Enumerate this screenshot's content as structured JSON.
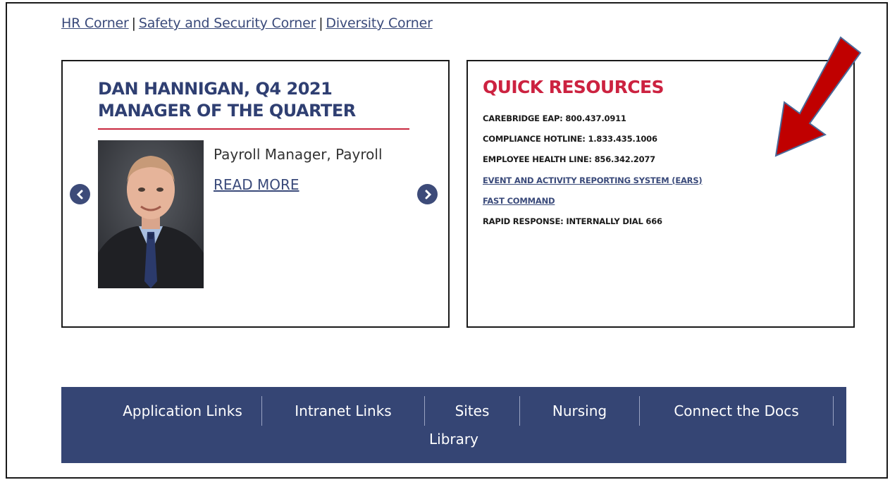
{
  "top_links": [
    {
      "label": "HR Corner"
    },
    {
      "label": "Safety and Security Corner"
    },
    {
      "label": "Diversity Corner"
    }
  ],
  "top_links_separator": "|",
  "manager_card": {
    "title": "DAN HANNIGAN, Q4 2021 MANAGER OF THE QUARTER",
    "role": "Payroll Manager, Payroll",
    "read_more": "READ MORE",
    "prev_icon": "chevron-left-icon",
    "next_icon": "chevron-right-icon"
  },
  "quick_resources": {
    "title": "QUICK RESOURCES",
    "items": [
      {
        "label": "CAREBRIDGE EAP: 800.437.0911",
        "link": false
      },
      {
        "label": "COMPLIANCE HOTLINE: 1.833.435.1006",
        "link": false
      },
      {
        "label": "EMPLOYEE HEALTH LINE: 856.342.2077",
        "link": false
      },
      {
        "label": "EVENT AND ACTIVITY REPORTING SYSTEM (EARS)",
        "link": true
      },
      {
        "label": "FAST COMMAND",
        "link": true
      },
      {
        "label": "RAPID RESPONSE: INTERNALLY DIAL 666",
        "link": false
      }
    ]
  },
  "nav": {
    "items": [
      "Application Links",
      "Intranet Links",
      "Sites",
      "Nursing",
      "Connect the Docs"
    ],
    "second_row": "Library"
  },
  "colors": {
    "nav_bg": "#354574",
    "title_navy": "#2f3f72",
    "accent_red": "#cc2240",
    "annotation_arrow": "#c00000"
  }
}
